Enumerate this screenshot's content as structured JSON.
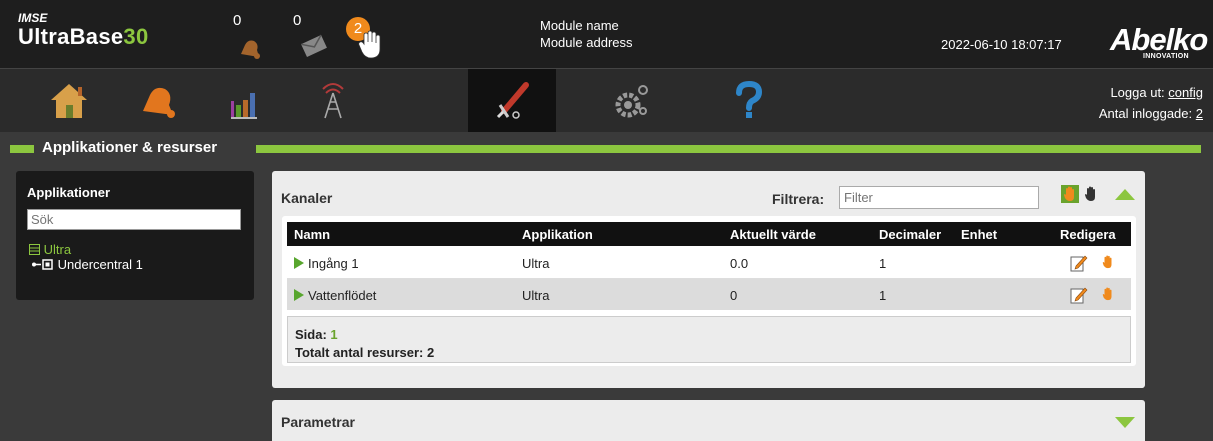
{
  "header": {
    "brand_small": "IMSE",
    "brand_main": "UltraBase",
    "brand_num": "30",
    "alarm_count": "0",
    "message_count": "0",
    "hand_badge": "2",
    "module_name": "Module name",
    "module_address": "Module address",
    "datetime": "2022-06-10 18:07:17",
    "logo": "Abelko",
    "logo_sub": "INNOVATION"
  },
  "nav": {
    "items": [
      {
        "name": "home-icon"
      },
      {
        "name": "bell-icon"
      },
      {
        "name": "bar-chart-icon"
      },
      {
        "name": "antenna-icon"
      },
      {
        "name": "tools-icon",
        "active": true
      },
      {
        "name": "gears-icon"
      },
      {
        "name": "help-icon"
      }
    ],
    "logout_label": "Logga ut:",
    "logout_user": "config",
    "logged_in_label": "Antal inloggade:",
    "logged_in_count": "2"
  },
  "section": {
    "title": "Applikationer & resurser"
  },
  "apps": {
    "title": "Applikationer",
    "search_placeholder": "Sök",
    "tree_root": "Ultra",
    "tree_child": "Undercentral 1"
  },
  "channels": {
    "title": "Kanaler",
    "filter_label": "Filtrera:",
    "filter_placeholder": "Filter",
    "columns": [
      "Namn",
      "Applikation",
      "Aktuellt värde",
      "Decimaler",
      "Enhet",
      "Redigera"
    ],
    "rows": [
      {
        "name": "Ingång 1",
        "app": "Ultra",
        "value": "0.0",
        "decimals": "1",
        "unit": ""
      },
      {
        "name": "Vattenflödet",
        "app": "Ultra",
        "value": "0",
        "decimals": "1",
        "unit": ""
      }
    ],
    "page_label": "Sida:",
    "page_value": "1",
    "total_label": "Totalt antal resurser: 2"
  },
  "parameters": {
    "title": "Parametrar"
  },
  "colors": {
    "accent_green": "#8cc63f",
    "orange": "#f08a1c",
    "dark": "#1e1e1e"
  }
}
